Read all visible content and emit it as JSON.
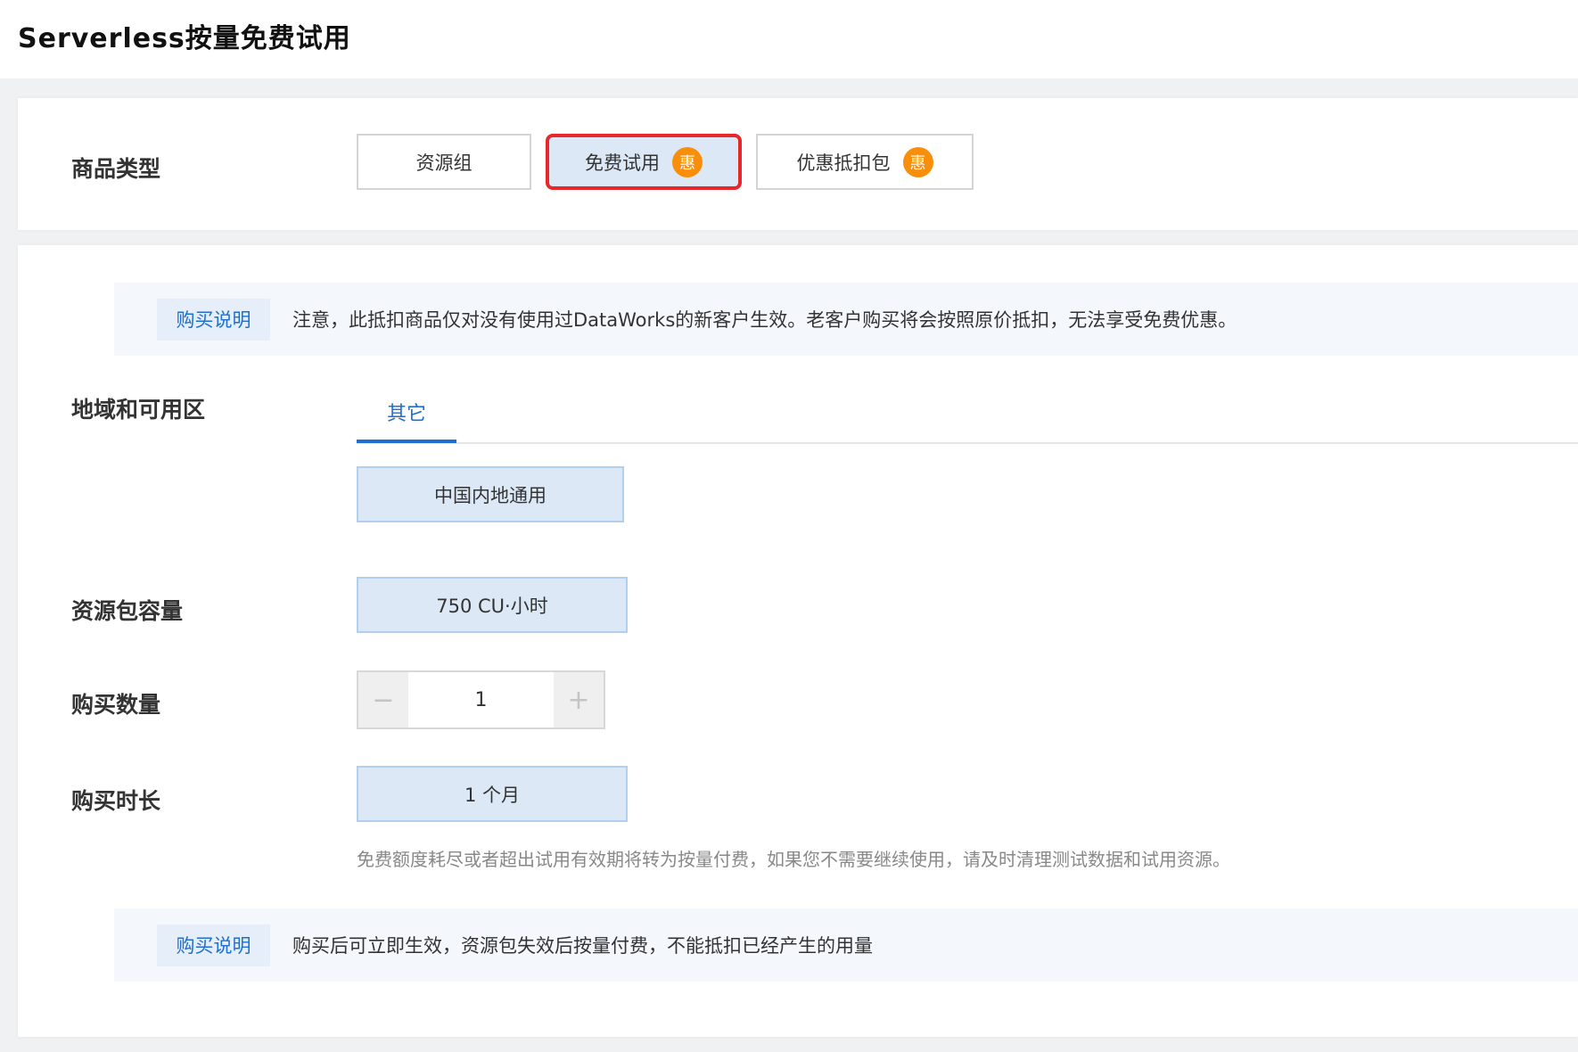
{
  "page_title": "Serverless按量免费试用",
  "product_type": {
    "label": "商品类型",
    "options": [
      {
        "label": "资源组",
        "badge": null,
        "selected": false
      },
      {
        "label": "免费试用",
        "badge": "惠",
        "selected": true
      },
      {
        "label": "优惠抵扣包",
        "badge": "惠",
        "selected": false
      }
    ]
  },
  "notice1": {
    "tag": "购买说明",
    "text": "注意，此抵扣商品仅对没有使用过DataWorks的新客户生效。老客户购买将会按照原价抵扣，无法享受免费优惠。"
  },
  "region": {
    "label": "地域和可用区",
    "tab": "其它",
    "value": "中国内地通用"
  },
  "capacity": {
    "label": "资源包容量",
    "value": "750 CU·小时"
  },
  "quantity": {
    "label": "购买数量",
    "value": "1",
    "minus": "−",
    "plus": "+"
  },
  "duration": {
    "label": "购买时长",
    "value": "1 个月",
    "hint": "免费额度耗尽或者超出试用有效期将转为按量付费，如果您不需要继续使用，请及时清理测试数据和试用资源。"
  },
  "notice2": {
    "tag": "购买说明",
    "text": "购买后可立即生效，资源包失效后按量付费，不能抵扣已经产生的用量"
  },
  "colors": {
    "accent": "#1f6fd0",
    "badge": "#f98e0a",
    "highlight": "#e8272a"
  }
}
